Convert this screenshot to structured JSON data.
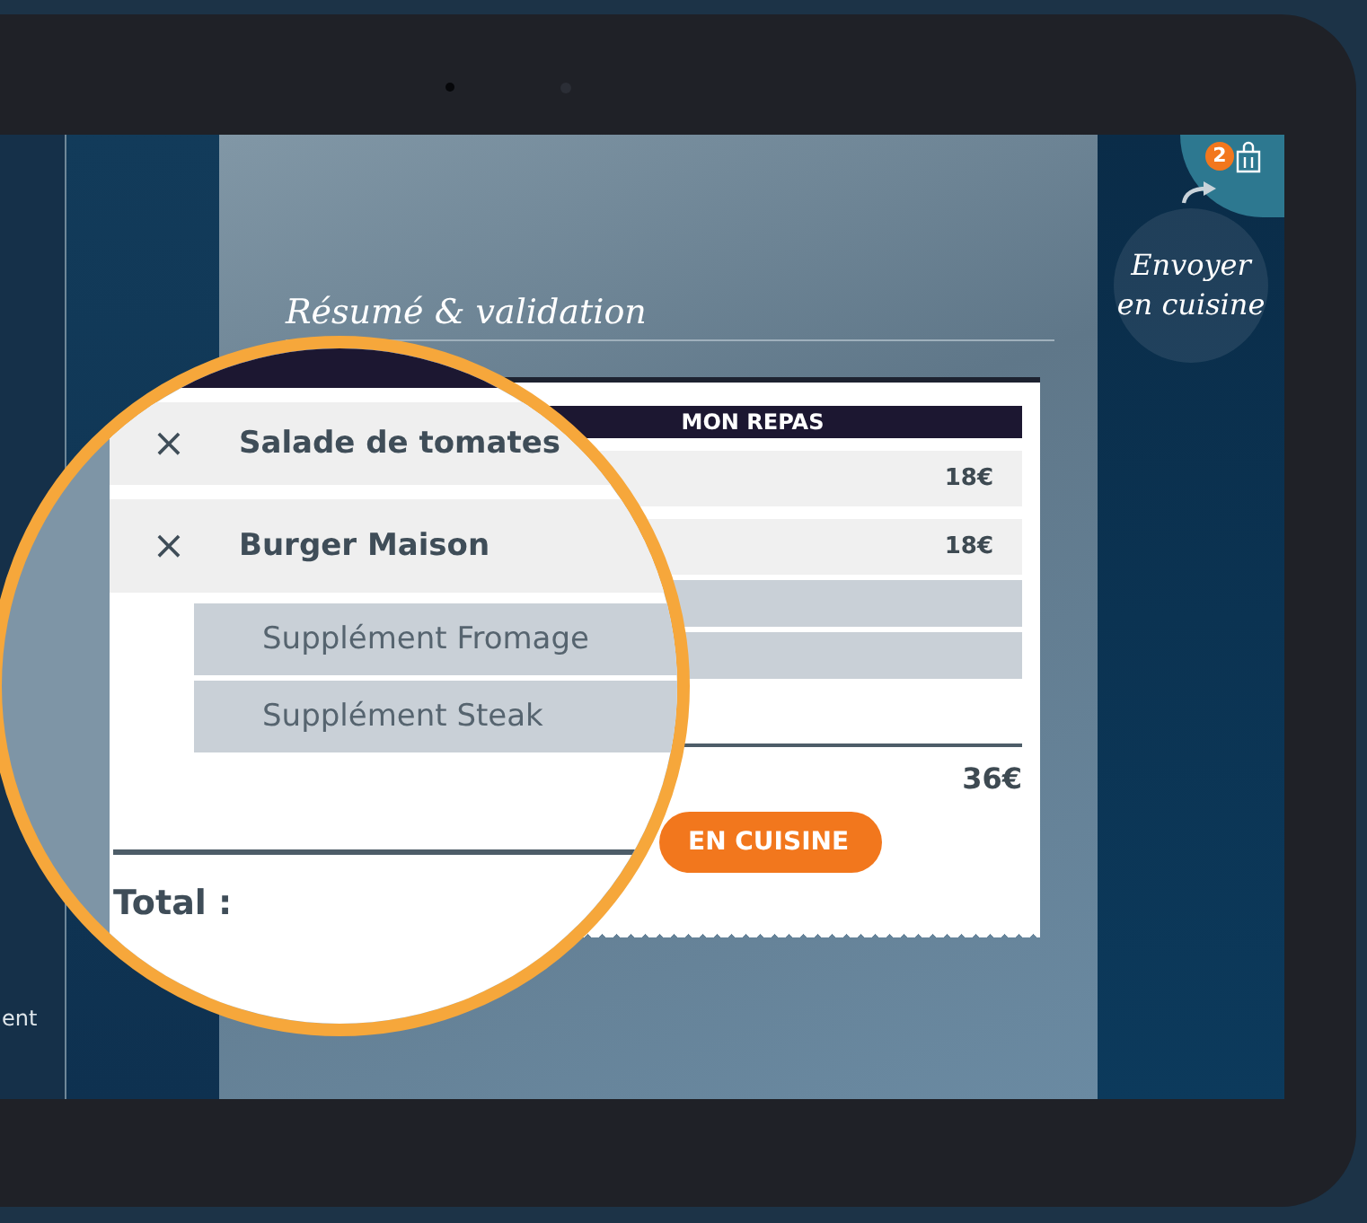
{
  "left_sidebar": {
    "partial_label": "ent"
  },
  "summary": {
    "title": "Résumé & validation",
    "receipt": {
      "header": "MON REPAS",
      "rows": [
        {
          "kind": "dish",
          "price": "18€"
        },
        {
          "kind": "dish",
          "price": "18€"
        },
        {
          "kind": "supplement"
        },
        {
          "kind": "supplement"
        }
      ],
      "total": "36€",
      "send_button": "EN CUISINE"
    }
  },
  "magnifier": {
    "rows": [
      {
        "kind": "dish",
        "remove": "×",
        "name": "Salade de tomates"
      },
      {
        "kind": "dish",
        "remove": "×",
        "name": "Burger Maison"
      },
      {
        "kind": "supplement",
        "name": "Supplément Fromage"
      },
      {
        "kind": "supplement",
        "name": "Supplément Steak"
      }
    ],
    "total_label": "Total :"
  },
  "send_panel": {
    "badge": "2",
    "label": "Envoyer en cuisine"
  }
}
